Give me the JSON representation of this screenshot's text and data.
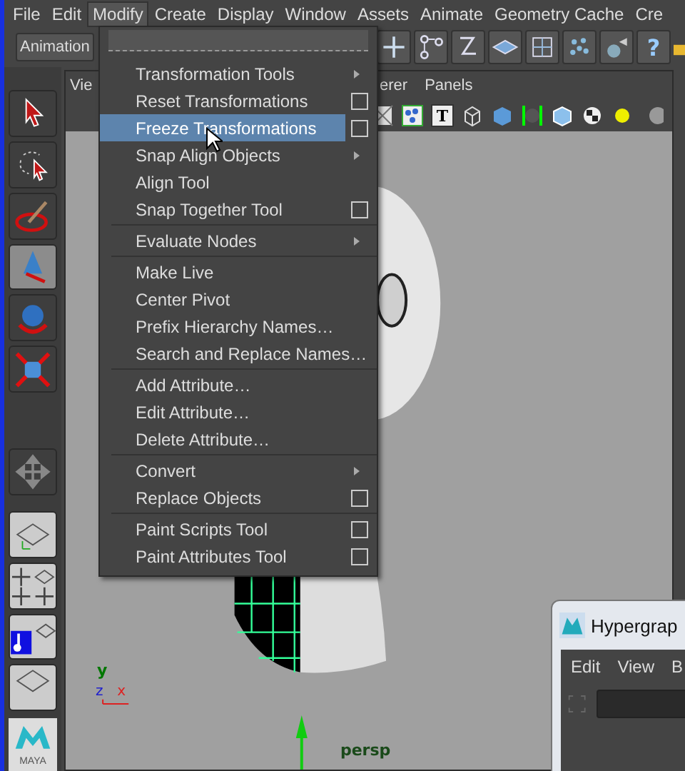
{
  "menubar": [
    {
      "label": "File",
      "selected": false
    },
    {
      "label": "Edit",
      "selected": false
    },
    {
      "label": "Modify",
      "selected": true
    },
    {
      "label": "Create",
      "selected": false
    },
    {
      "label": "Display",
      "selected": false
    },
    {
      "label": "Window",
      "selected": false
    },
    {
      "label": "Assets",
      "selected": false
    },
    {
      "label": "Animate",
      "selected": false
    },
    {
      "label": "Geometry Cache",
      "selected": false
    },
    {
      "label": "Cre",
      "selected": false
    }
  ],
  "toolbar": {
    "menu_set": "Animation",
    "help_button": "?"
  },
  "panel": {
    "menu": [
      "Vie",
      "erer",
      "Panels"
    ],
    "text_button": "T"
  },
  "tools": [
    {
      "kind": "select",
      "selected": false
    },
    {
      "kind": "lasso",
      "selected": false
    },
    {
      "kind": "paint",
      "selected": false
    },
    {
      "kind": "move",
      "selected": true
    },
    {
      "kind": "rotate",
      "selected": false
    },
    {
      "kind": "scale",
      "selected": false
    }
  ],
  "menu": {
    "groups": [
      [
        {
          "label": "Transformation Tools",
          "kind": "submenu",
          "selected": false
        },
        {
          "label": "Reset Transformations",
          "kind": "option",
          "selected": false
        },
        {
          "label": "Freeze Transformations",
          "kind": "option",
          "selected": true
        },
        {
          "label": "Snap Align Objects",
          "kind": "submenu",
          "selected": false
        },
        {
          "label": "Align Tool",
          "kind": "plain",
          "selected": false
        },
        {
          "label": "Snap Together Tool",
          "kind": "option",
          "selected": false
        }
      ],
      [
        {
          "label": "Evaluate Nodes",
          "kind": "submenu",
          "selected": false
        }
      ],
      [
        {
          "label": "Make Live",
          "kind": "plain",
          "selected": false
        },
        {
          "label": "Center Pivot",
          "kind": "plain",
          "selected": false
        },
        {
          "label": "Prefix Hierarchy Names…",
          "kind": "plain",
          "selected": false
        },
        {
          "label": "Search and Replace Names…",
          "kind": "plain",
          "selected": false
        }
      ],
      [
        {
          "label": "Add Attribute…",
          "kind": "plain",
          "selected": false
        },
        {
          "label": "Edit Attribute…",
          "kind": "plain",
          "selected": false
        },
        {
          "label": "Delete Attribute…",
          "kind": "plain",
          "selected": false
        }
      ],
      [
        {
          "label": "Convert",
          "kind": "submenu",
          "selected": false
        },
        {
          "label": "Replace Objects",
          "kind": "option",
          "selected": false
        }
      ],
      [
        {
          "label": "Paint Scripts Tool",
          "kind": "option",
          "selected": false
        },
        {
          "label": "Paint Attributes Tool",
          "kind": "option",
          "selected": false
        }
      ]
    ]
  },
  "viewport": {
    "camera": "persp",
    "axes": [
      "y",
      "z",
      "x"
    ]
  },
  "logo": "MAYA",
  "hypergraph": {
    "title": "Hypergrap",
    "menu": [
      "Edit",
      "View",
      "B"
    ]
  }
}
